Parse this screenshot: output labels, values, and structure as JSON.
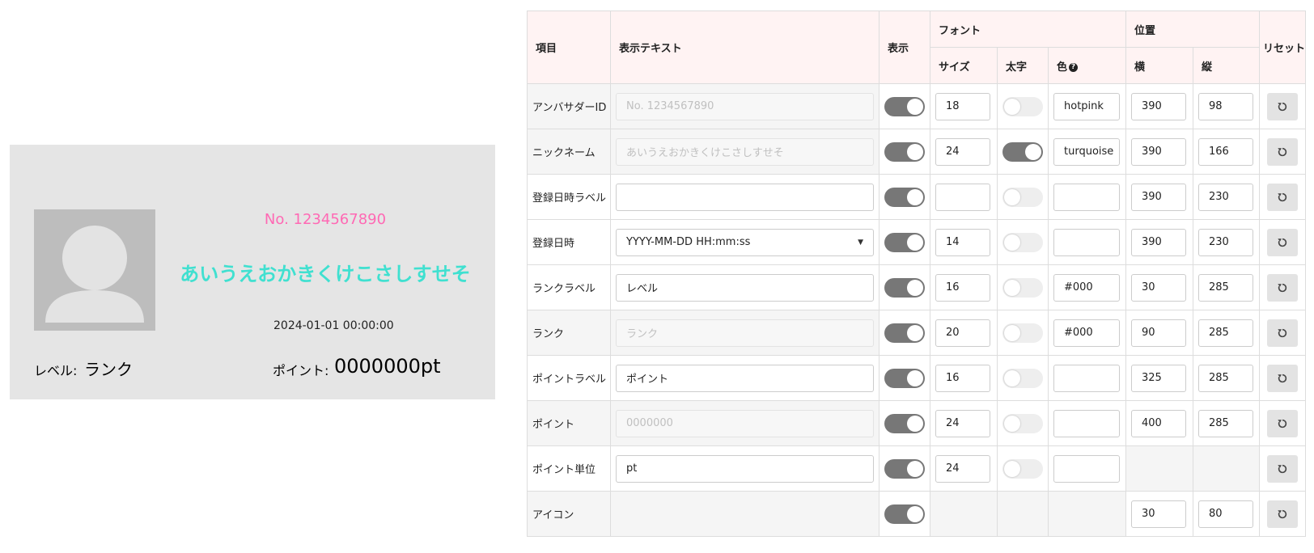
{
  "preview": {
    "ambassador_id": "No. 1234567890",
    "nickname": "あいうえおかきくけこさしすせそ",
    "registered_at": "2024-01-01 00:00:00",
    "rank_label": "レベル:",
    "rank": "ランク",
    "point_label": "ポイント:",
    "point": "0000000",
    "point_unit": "pt",
    "colors": {
      "id": "#ff69b4",
      "nickname": "#40e0d0",
      "background": "#e5e5e5"
    }
  },
  "table": {
    "headers": {
      "item": "項目",
      "display_text": "表示テキスト",
      "visible": "表示",
      "font": "フォント",
      "position": "位置",
      "reset": "リセット",
      "size": "サイズ",
      "bold": "太字",
      "color": "色",
      "horizontal": "横",
      "vertical": "縦"
    },
    "rows": [
      {
        "name": "アンバサダーID",
        "text": "No. 1234567890",
        "size": "18",
        "color": "hotpink",
        "x": "390",
        "y": "98"
      },
      {
        "name": "ニックネーム",
        "text": "あいうえおかきくけこさしすせそ",
        "size": "24",
        "color": "turquoise",
        "x": "390",
        "y": "166"
      },
      {
        "name": "登録日時ラベル",
        "text": "",
        "size": "",
        "color": "",
        "x": "390",
        "y": "230"
      },
      {
        "name": "登録日時",
        "text": "YYYY-MM-DD HH:mm:ss",
        "size": "14",
        "color": "",
        "x": "390",
        "y": "230"
      },
      {
        "name": "ランクラベル",
        "text": "レベル",
        "size": "16",
        "color": "#000",
        "x": "30",
        "y": "285"
      },
      {
        "name": "ランク",
        "text": "ランク",
        "size": "20",
        "color": "#000",
        "x": "90",
        "y": "285"
      },
      {
        "name": "ポイントラベル",
        "text": "ポイント",
        "size": "16",
        "color": "",
        "x": "325",
        "y": "285"
      },
      {
        "name": "ポイント",
        "text": "0000000",
        "size": "24",
        "color": "",
        "x": "400",
        "y": "285"
      },
      {
        "name": "ポイント単位",
        "text": "pt",
        "size": "24",
        "color": ""
      },
      {
        "name": "アイコン",
        "x": "30",
        "y": "80"
      }
    ]
  }
}
